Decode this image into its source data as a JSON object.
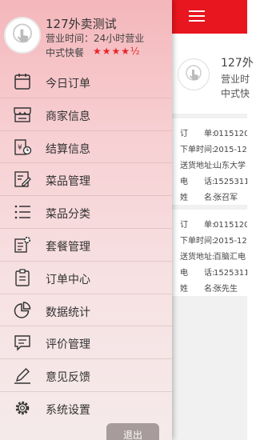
{
  "shop": {
    "name": "127外卖测试",
    "hours": "营业时间：24小时营业",
    "type": "中式快餐",
    "rating_stars": "★★★★½",
    "rating": 4.5
  },
  "menu": [
    {
      "label": "今日订单",
      "icon": "calendar-icon"
    },
    {
      "label": "商家信息",
      "icon": "store-icon"
    },
    {
      "label": "结算信息",
      "icon": "settlement-icon"
    },
    {
      "label": "菜品管理",
      "icon": "edit-document-icon"
    },
    {
      "label": "菜品分类",
      "icon": "list-icon"
    },
    {
      "label": "套餐管理",
      "icon": "package-settings-icon"
    },
    {
      "label": "订单中心",
      "icon": "clipboard-icon"
    },
    {
      "label": "数据统计",
      "icon": "pie-chart-icon"
    },
    {
      "label": "评价管理",
      "icon": "comment-icon"
    },
    {
      "label": "意见反馈",
      "icon": "pen-icon"
    },
    {
      "label": "系统设置",
      "icon": "gear-icon"
    }
  ],
  "logout_label": "退出",
  "main": {
    "shop_name": "127外",
    "shop_hours": "营业时",
    "shop_type": "中式快",
    "orders": [
      {
        "order_no_label": "订　　单:",
        "order_no": "0115120",
        "time_label": "下单时间:",
        "time": "2015-12",
        "address_label": "送货地址:",
        "address": "山东大学",
        "phone_label": "电　　话:",
        "phone": "1525311",
        "name_label": "姓　　名:",
        "name": "张召军"
      },
      {
        "order_no_label": "订　　单:",
        "order_no": "0115120",
        "time_label": "下单时间:",
        "time": "2015-12",
        "address_label": "送货地址:",
        "address": "百脑汇电",
        "phone_label": "电　　话:",
        "phone": "1525311",
        "name_label": "姓　　名:",
        "name": "张先生"
      }
    ]
  },
  "colors": {
    "accent": "#e8161e",
    "star": "#e8242a"
  }
}
